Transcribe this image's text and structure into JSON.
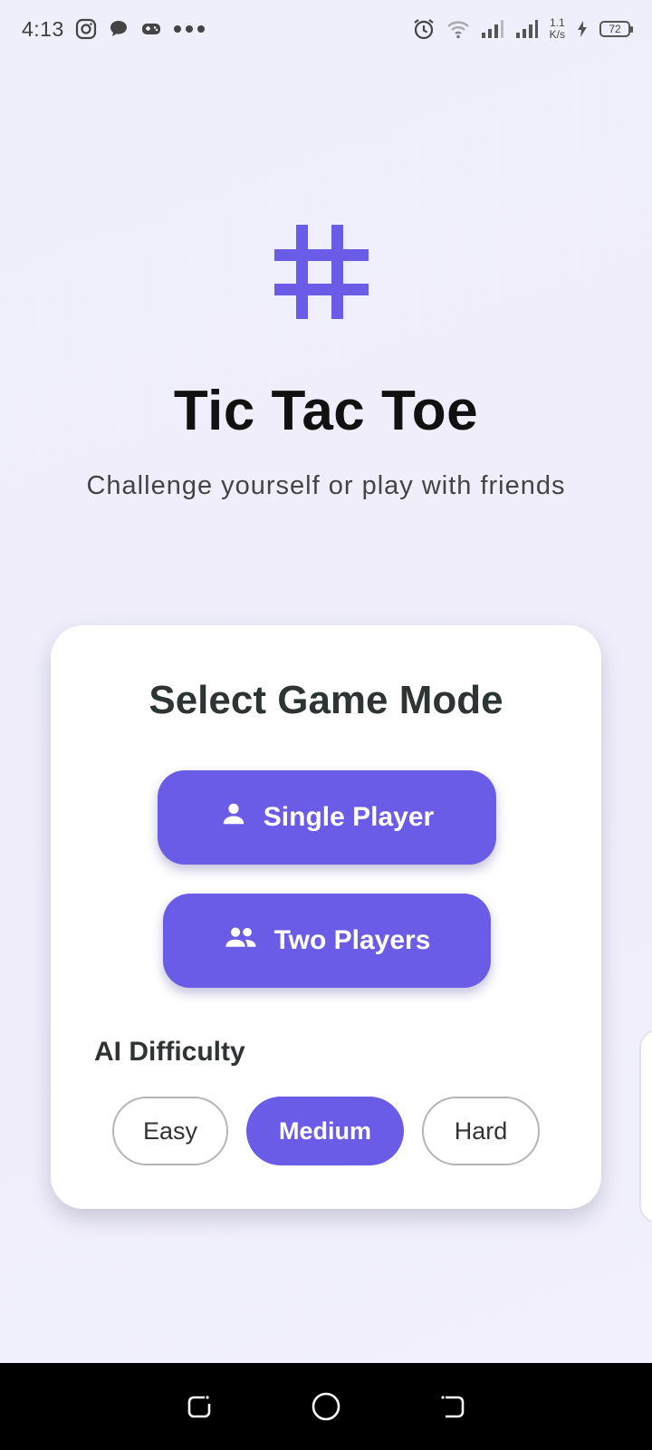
{
  "status_bar": {
    "time": "4:13",
    "notification_icons": [
      "instagram-icon",
      "chat-bubble-icon",
      "gamepad-icon",
      "more-dots-icon"
    ],
    "speed_value": "1.1",
    "speed_unit": "K/s",
    "battery": "72"
  },
  "app": {
    "title": "Tic Tac Toe",
    "subtitle": "Challenge yourself or play with friends",
    "logo_icon": "hash-grid-icon",
    "accent_color": "#6b5ce7"
  },
  "card": {
    "title": "Select Game Mode",
    "single_player_label": "Single Player",
    "two_players_label": "Two Players",
    "difficulty_label": "AI Difficulty",
    "difficulty_options": [
      "Easy",
      "Medium",
      "Hard"
    ],
    "selected_difficulty": "Medium"
  }
}
